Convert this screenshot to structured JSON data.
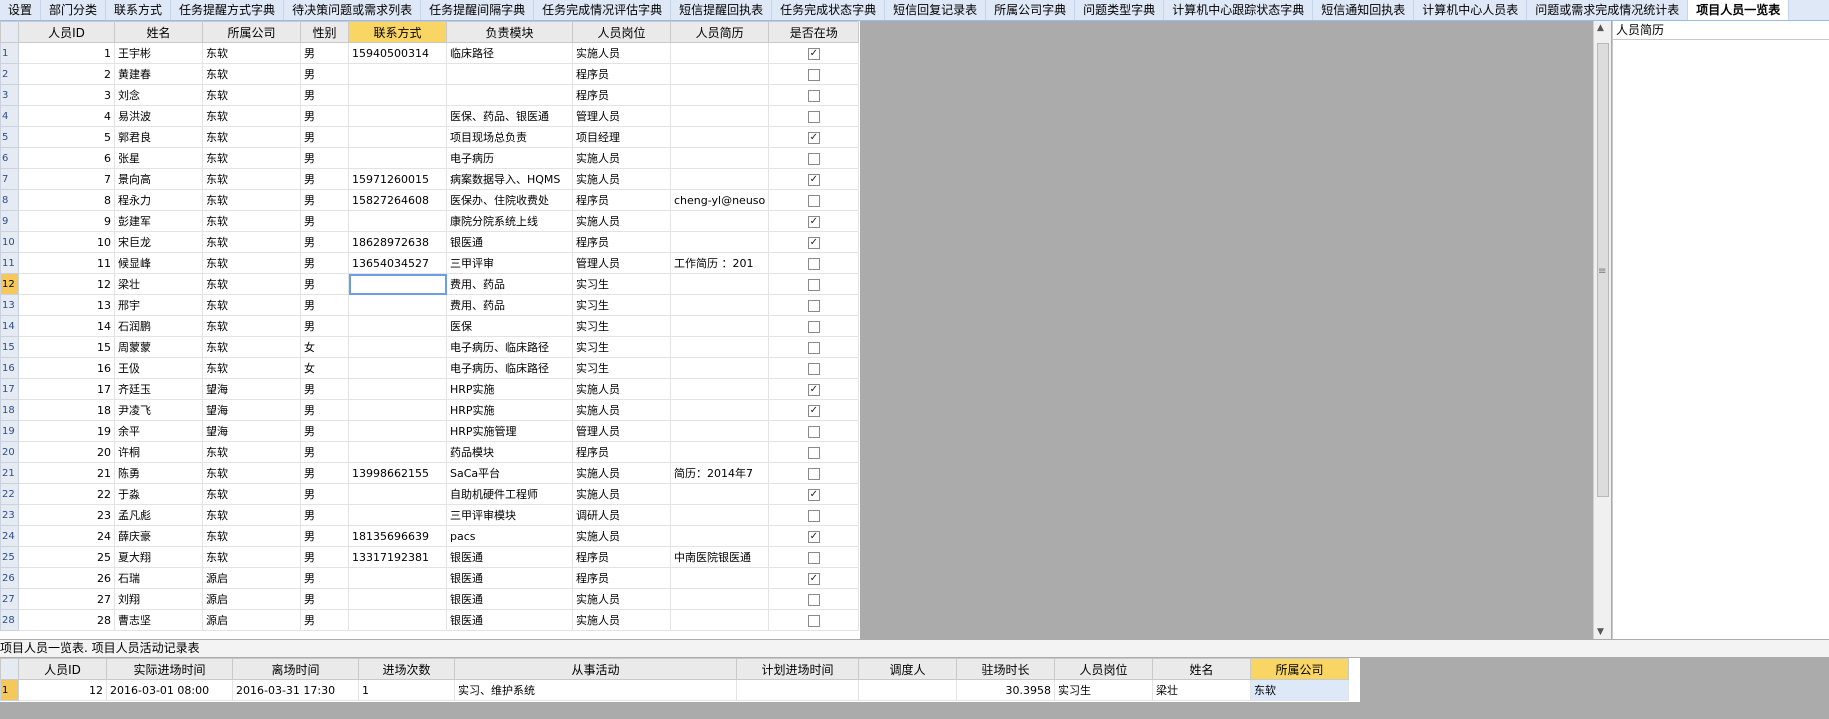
{
  "tabs": [
    "设置",
    "部门分类",
    "联系方式",
    "任务提醒方式字典",
    "待决策问题或需求列表",
    "任务提醒间隔字典",
    "任务完成情况评估字典",
    "短信提醒回执表",
    "任务完成状态字典",
    "短信回复记录表",
    "所属公司字典",
    "问题类型字典",
    "计算机中心跟踪状态字典",
    "短信通知回执表",
    "计算机中心人员表",
    "问题或需求完成情况统计表",
    "项目人员一览表"
  ],
  "main_grid": {
    "columns": [
      "人员ID",
      "姓名",
      "所属公司",
      "性别",
      "联系方式",
      "负责模块",
      "人员岗位",
      "人员简历",
      "是否在场"
    ],
    "selected_column": 4,
    "current_row": 12,
    "rows": [
      {
        "rn": "1",
        "id": "1",
        "name": "王宇彬",
        "company": "东软",
        "gender": "男",
        "contact": "15940500314",
        "module": "临床路径",
        "post": "实施人员",
        "resume": "",
        "onsite": true
      },
      {
        "rn": "2",
        "id": "2",
        "name": "黄建春",
        "company": "东软",
        "gender": "男",
        "contact": "",
        "module": "",
        "post": "程序员",
        "resume": "",
        "onsite": false
      },
      {
        "rn": "3",
        "id": "3",
        "name": "刘念",
        "company": "东软",
        "gender": "男",
        "contact": "",
        "module": "",
        "post": "程序员",
        "resume": "",
        "onsite": false
      },
      {
        "rn": "4",
        "id": "4",
        "name": "易洪波",
        "company": "东软",
        "gender": "男",
        "contact": "",
        "module": "医保、药品、银医通",
        "post": "管理人员",
        "resume": "",
        "onsite": false
      },
      {
        "rn": "5",
        "id": "5",
        "name": "郭君良",
        "company": "东软",
        "gender": "男",
        "contact": "",
        "module": "项目现场总负责",
        "post": "项目经理",
        "resume": "",
        "onsite": true
      },
      {
        "rn": "6",
        "id": "6",
        "name": "张星",
        "company": "东软",
        "gender": "男",
        "contact": "",
        "module": "电子病历",
        "post": "实施人员",
        "resume": "",
        "onsite": false
      },
      {
        "rn": "7",
        "id": "7",
        "name": "景向高",
        "company": "东软",
        "gender": "男",
        "contact": "15971260015",
        "module": "病案数据导入、HQMS",
        "post": "实施人员",
        "resume": "",
        "onsite": true
      },
      {
        "rn": "8",
        "id": "8",
        "name": "程永力",
        "company": "东软",
        "gender": "男",
        "contact": "15827264608",
        "module": "医保办、住院收费处",
        "post": "程序员",
        "resume": "cheng-yl@neuso",
        "onsite": false
      },
      {
        "rn": "9",
        "id": "9",
        "name": "彭建军",
        "company": "东软",
        "gender": "男",
        "contact": "",
        "module": "康院分院系统上线",
        "post": "实施人员",
        "resume": "",
        "onsite": true
      },
      {
        "rn": "10",
        "id": "10",
        "name": "宋巨龙",
        "company": "东软",
        "gender": "男",
        "contact": "18628972638",
        "module": "银医通",
        "post": "程序员",
        "resume": "",
        "onsite": true
      },
      {
        "rn": "11",
        "id": "11",
        "name": "候显峰",
        "company": "东软",
        "gender": "男",
        "contact": "13654034527",
        "module": "三甲评审",
        "post": "管理人员",
        "resume": "工作简历 ：201",
        "onsite": false
      },
      {
        "rn": "12",
        "id": "12",
        "name": "梁壮",
        "company": "东软",
        "gender": "男",
        "contact": "",
        "module": "费用、药品",
        "post": "实习生",
        "resume": "",
        "onsite": false
      },
      {
        "rn": "13",
        "id": "13",
        "name": "邢宇",
        "company": "东软",
        "gender": "男",
        "contact": "",
        "module": "费用、药品",
        "post": "实习生",
        "resume": "",
        "onsite": false
      },
      {
        "rn": "14",
        "id": "14",
        "name": "石润鹏",
        "company": "东软",
        "gender": "男",
        "contact": "",
        "module": "医保",
        "post": "实习生",
        "resume": "",
        "onsite": false
      },
      {
        "rn": "15",
        "id": "15",
        "name": "周蒙蒙",
        "company": "东软",
        "gender": "女",
        "contact": "",
        "module": "电子病历、临床路径",
        "post": "实习生",
        "resume": "",
        "onsite": false
      },
      {
        "rn": "16",
        "id": "16",
        "name": "王伋",
        "company": "东软",
        "gender": "女",
        "contact": "",
        "module": "电子病历、临床路径",
        "post": "实习生",
        "resume": "",
        "onsite": false
      },
      {
        "rn": "17",
        "id": "17",
        "name": "齐廷玉",
        "company": "望海",
        "gender": "男",
        "contact": "",
        "module": "HRP实施",
        "post": "实施人员",
        "resume": "",
        "onsite": true
      },
      {
        "rn": "18",
        "id": "18",
        "name": "尹凌飞",
        "company": "望海",
        "gender": "男",
        "contact": "",
        "module": "HRP实施",
        "post": "实施人员",
        "resume": "",
        "onsite": true
      },
      {
        "rn": "19",
        "id": "19",
        "name": "余平",
        "company": "望海",
        "gender": "男",
        "contact": "",
        "module": "HRP实施管理",
        "post": "管理人员",
        "resume": "",
        "onsite": false
      },
      {
        "rn": "20",
        "id": "20",
        "name": "许桐",
        "company": "东软",
        "gender": "男",
        "contact": "",
        "module": "药品模块",
        "post": "程序员",
        "resume": "",
        "onsite": false
      },
      {
        "rn": "21",
        "id": "21",
        "name": "陈勇",
        "company": "东软",
        "gender": "男",
        "contact": "13998662155",
        "module": "SaCa平台",
        "post": "实施人员",
        "resume": "简历：2014年7",
        "onsite": false
      },
      {
        "rn": "22",
        "id": "22",
        "name": "于淼",
        "company": "东软",
        "gender": "男",
        "contact": "",
        "module": "自助机硬件工程师",
        "post": "实施人员",
        "resume": "",
        "onsite": true
      },
      {
        "rn": "23",
        "id": "23",
        "name": "孟凡彪",
        "company": "东软",
        "gender": "男",
        "contact": "",
        "module": "三甲评审模块",
        "post": "调研人员",
        "resume": "",
        "onsite": false
      },
      {
        "rn": "24",
        "id": "24",
        "name": "薛庆豪",
        "company": "东软",
        "gender": "男",
        "contact": "18135696639",
        "module": "pacs",
        "post": "实施人员",
        "resume": "",
        "onsite": true
      },
      {
        "rn": "25",
        "id": "25",
        "name": "夏大翔",
        "company": "东软",
        "gender": "男",
        "contact": "13317192381",
        "module": "银医通",
        "post": "程序员",
        "resume": "中南医院银医通",
        "onsite": false
      },
      {
        "rn": "26",
        "id": "26",
        "name": "石瑞",
        "company": "源启",
        "gender": "男",
        "contact": "",
        "module": "银医通",
        "post": "程序员",
        "resume": "",
        "onsite": true
      },
      {
        "rn": "27",
        "id": "27",
        "name": "刘翔",
        "company": "源启",
        "gender": "男",
        "contact": "",
        "module": "银医通",
        "post": "实施人员",
        "resume": "",
        "onsite": false
      },
      {
        "rn": "28",
        "id": "28",
        "name": "曹志坚",
        "company": "源启",
        "gender": "男",
        "contact": "",
        "module": "银医通",
        "post": "实施人员",
        "resume": "",
        "onsite": false
      }
    ]
  },
  "resume_panel": {
    "header": "人员简历"
  },
  "caption": "项目人员一览表. 项目人员活动记录表",
  "sub_grid": {
    "columns": [
      "人员ID",
      "实际进场时间",
      "离场时间",
      "进场次数",
      "从事活动",
      "计划进场时间",
      "调度人",
      "驻场时长",
      "人员岗位",
      "姓名",
      "所属公司"
    ],
    "selected_column": 10,
    "rows": [
      {
        "rn": "1",
        "id": "12",
        "arrive": "2016-03-01 08:00",
        "leave": "2016-03-31 17:30",
        "times": "1",
        "activity": "实习、维护系统",
        "plan": "",
        "dispatcher": "",
        "duration": "30.3958",
        "post": "实习生",
        "name": "梁壮",
        "company": "东软"
      }
    ]
  }
}
